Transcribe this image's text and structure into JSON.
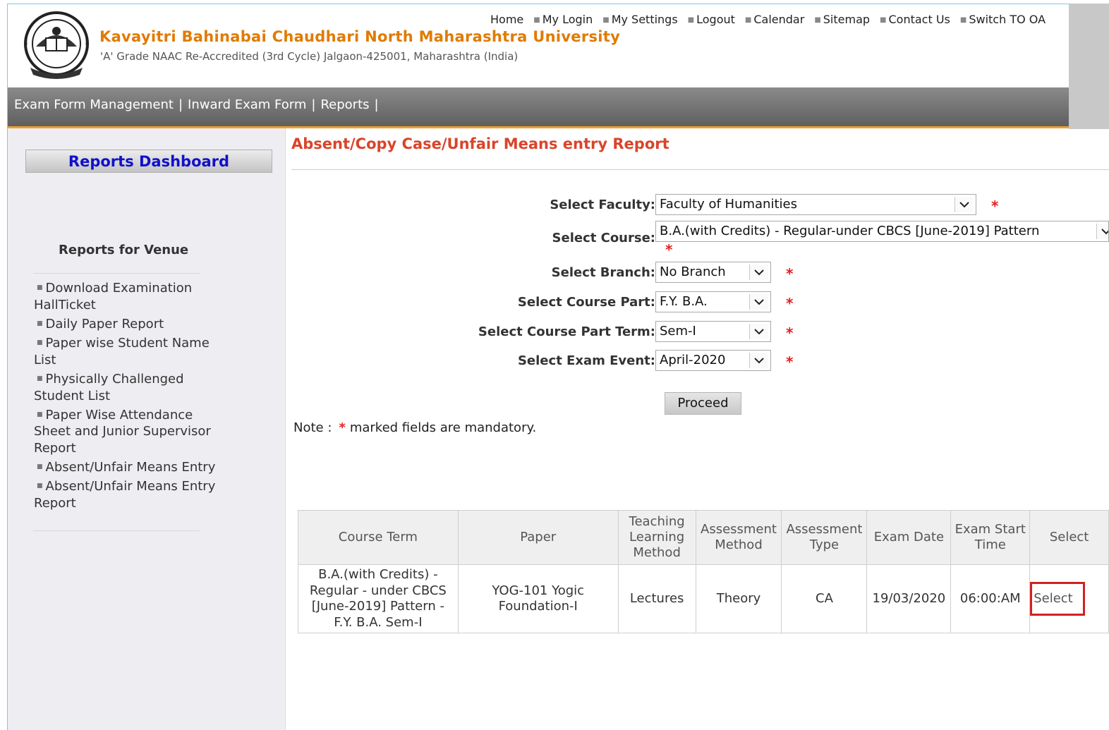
{
  "header": {
    "university_name": "Kavayitri Bahinabai Chaudhari North Maharashtra University",
    "subtitle": "'A' Grade NAAC Re-Accredited (3rd Cycle) Jalgaon-425001, Maharashtra (India)",
    "top_links": [
      "Home",
      "My Login",
      "My Settings",
      "Logout",
      "Calendar",
      "Sitemap",
      "Contact Us",
      "Switch TO OA"
    ]
  },
  "nav": {
    "items": [
      "Exam Form Management",
      "Inward Exam Form",
      "Reports"
    ]
  },
  "sidebar": {
    "dashboard_button": "Reports Dashboard",
    "section_title": "Reports for Venue",
    "items": [
      "Download Examination HallTicket",
      "Daily Paper Report",
      "Paper wise Student Name List",
      "Physically Challenged Student List",
      "Paper Wise Attendance Sheet and Junior Supervisor Report",
      "Absent/Unfair Means Entry",
      "Absent/Unfair Means Entry Report"
    ]
  },
  "main": {
    "title": "Absent/Copy Case/Unfair Means entry Report",
    "form": {
      "faculty_label": "Select Faculty:",
      "faculty_value": "Faculty of Humanities",
      "course_label": "Select Course:",
      "course_value": "B.A.(with Credits) - Regular-under CBCS [June-2019] Pattern",
      "branch_label": "Select Branch:",
      "branch_value": "No Branch",
      "course_part_label": "Select Course Part:",
      "course_part_value": "F.Y. B.A.",
      "term_label": "Select Course Part Term:",
      "term_value": "Sem-I",
      "exam_event_label": "Select Exam Event:",
      "exam_event_value": "April-2020",
      "required_mark": "*"
    },
    "proceed_label": "Proceed",
    "note_prefix": "Note :",
    "note_star": "*",
    "note_text": "marked fields are mandatory."
  },
  "table": {
    "headers": [
      "Course Term",
      "Paper",
      "Teaching Learning Method",
      "Assessment Method",
      "Assessment Type",
      "Exam Date",
      "Exam Start Time",
      "Select"
    ],
    "rows": [
      {
        "course_term": "B.A.(with Credits) - Regular - under CBCS [June-2019] Pattern - F.Y. B.A. Sem-I",
        "paper": "YOG-101 Yogic Foundation-I",
        "teaching_method": "Lectures",
        "assessment_method": "Theory",
        "assessment_type": "CA",
        "exam_date": "19/03/2020",
        "exam_start_time": "06:00:AM",
        "select": "Select"
      }
    ]
  },
  "colors": {
    "university_name": "#e07b00",
    "page_title": "#d9442a",
    "dashboard_text": "#1010cc",
    "required": "#e02020",
    "highlight_box": "#d32020"
  }
}
